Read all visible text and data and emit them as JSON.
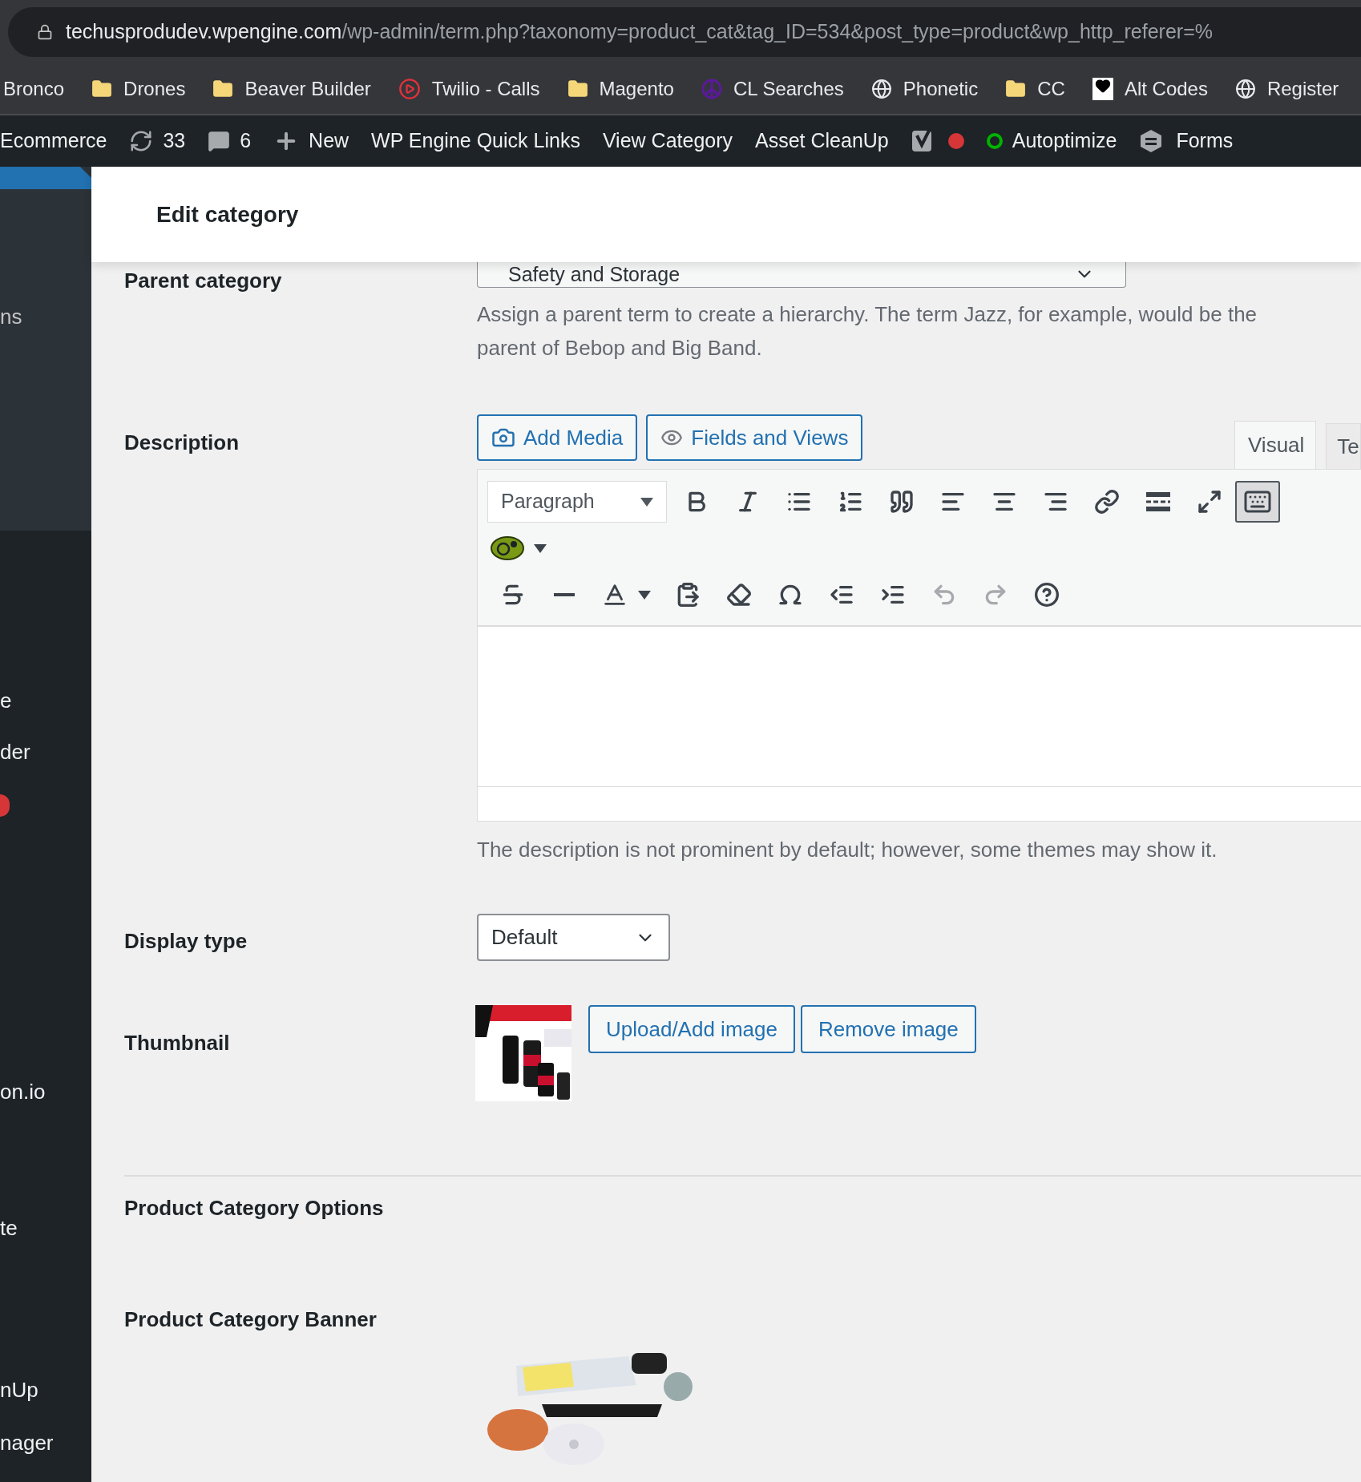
{
  "browser": {
    "url_host": "techusprodudev.wpengine.com",
    "url_path": "/wp-admin/term.php?taxonomy=product_cat&tag_ID=534&post_type=product&wp_http_referer=%",
    "bookmarks": [
      {
        "label": "Bronco",
        "kind": "plain"
      },
      {
        "label": "Drones",
        "kind": "folder"
      },
      {
        "label": "Beaver Builder",
        "kind": "folder"
      },
      {
        "label": "Twilio - Calls",
        "kind": "twilio"
      },
      {
        "label": "Magento",
        "kind": "folder"
      },
      {
        "label": "CL Searches",
        "kind": "peace"
      },
      {
        "label": "Phonetic",
        "kind": "globe"
      },
      {
        "label": "CC",
        "kind": "folder"
      },
      {
        "label": "Alt Codes",
        "kind": "heart"
      },
      {
        "label": "Register",
        "kind": "globe"
      }
    ]
  },
  "admin_bar": [
    {
      "label": "Ecommerce",
      "kind": "text"
    },
    {
      "label": "33",
      "kind": "updates"
    },
    {
      "label": "6",
      "kind": "comments"
    },
    {
      "label": "New",
      "kind": "new"
    },
    {
      "label": "WP Engine Quick Links",
      "kind": "text"
    },
    {
      "label": "View Category",
      "kind": "text"
    },
    {
      "label": "Asset CleanUp",
      "kind": "text"
    },
    {
      "kind": "seo",
      "color": "#d63638"
    },
    {
      "label": "Autoptimize",
      "kind": "ring",
      "color": "#00b300"
    },
    {
      "label": "Forms",
      "kind": "forms"
    }
  ],
  "sidebar": {
    "items": [
      {
        "label": "ns",
        "kind": "text"
      },
      {
        "label": "e",
        "kind": "text"
      },
      {
        "label": "der",
        "kind": "text"
      },
      {
        "kind": "bubble"
      },
      {
        "label": "on.io",
        "kind": "text"
      },
      {
        "label": "te",
        "kind": "text"
      },
      {
        "label": "nUp",
        "kind": "text"
      },
      {
        "label": "nager",
        "kind": "text"
      }
    ]
  },
  "header": {
    "title": "Edit category"
  },
  "form": {
    "parent_category": {
      "label": "Parent category",
      "value": "Safety and Storage",
      "help": "Assign a parent term to create a hierarchy. The term Jazz, for example, would be the parent of Bebop and Big Band."
    },
    "description": {
      "label": "Description",
      "buttons": [
        {
          "label": "Add Media",
          "kind": "media"
        },
        {
          "label": "Fields and Views",
          "kind": "views"
        }
      ],
      "tabs": [
        {
          "label": "Visual",
          "selected": true
        },
        {
          "label": "Te",
          "selected": false
        }
      ],
      "format": "Paragraph",
      "toolbar_toggle": {
        "on": true
      },
      "help": "The description is not prominent by default; however, some themes may show it."
    },
    "display_type": {
      "label": "Display type",
      "value": "Default"
    },
    "thumbnail": {
      "label": "Thumbnail",
      "buttons": [
        "Upload/Add image",
        "Remove image"
      ]
    },
    "section_title": "Product Category Options",
    "banner": {
      "label": "Product Category Banner"
    }
  }
}
